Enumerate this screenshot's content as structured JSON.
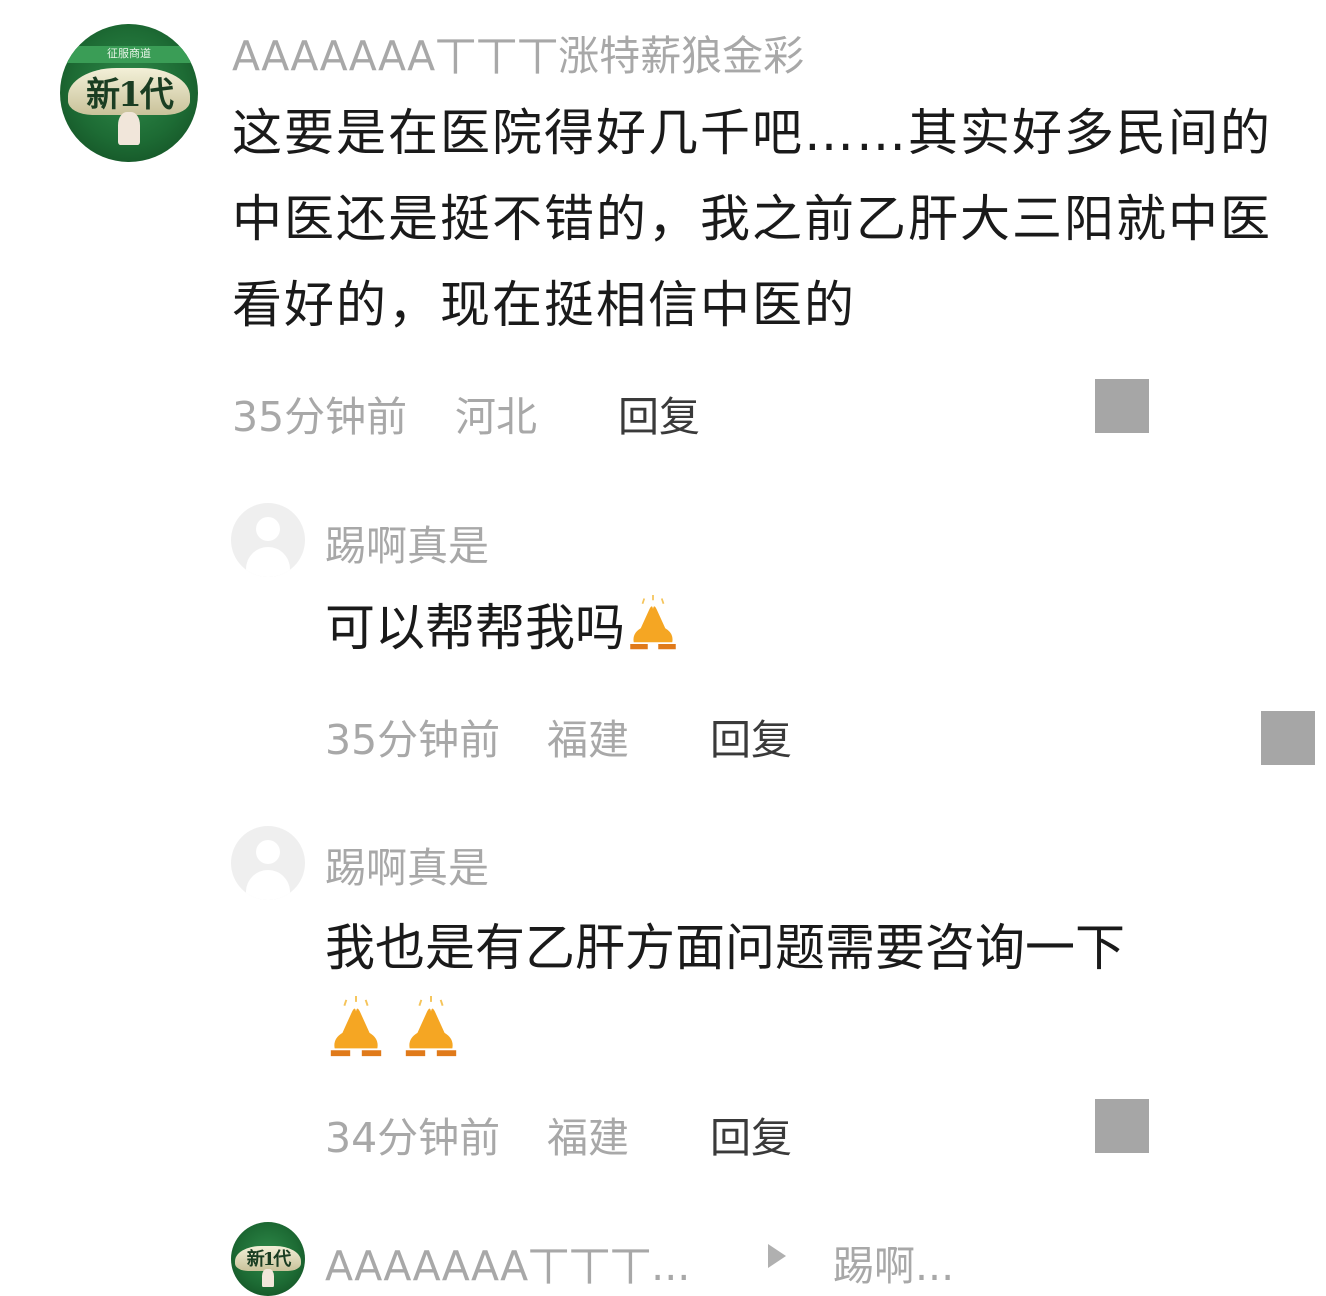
{
  "comments": [
    {
      "username": "AAAAAAA丅丅丅涨特薪狼金彩",
      "text": "这要是在医院得好几千吧……其实好多民间的中医还是挺不错的，我之前乙肝大三阳就中医看好的，现在挺相信中医的",
      "time": "35分钟前",
      "location": "河北",
      "reply_label": "回复",
      "avatar_banner": "征服商道",
      "avatar_logo": "新1代"
    }
  ],
  "replies": [
    {
      "username": "踢啊真是",
      "text": "可以帮帮我吗",
      "emoji_count": 1,
      "time": "35分钟前",
      "location": "福建",
      "reply_label": "回复"
    },
    {
      "username": "踢啊真是",
      "text": "我也是有乙肝方面问题需要咨询一下",
      "emoji_count": 2,
      "time": "34分钟前",
      "location": "福建",
      "reply_label": "回复"
    }
  ],
  "thread_footer": {
    "from_user": "AAAAAAA丅丅丅...",
    "to_user": "踢啊...",
    "avatar_logo": "新1代"
  },
  "icons": {
    "emoji": "folded-hands",
    "menu": "more-square",
    "arrow": "play-triangle"
  },
  "colors": {
    "username": "#a8a8a8",
    "text": "#1a1a1a",
    "meta": "#a8a8a8",
    "reply": "#3a3a3a",
    "menu_box": "#a6a6a6",
    "avatar_green": "#1d6b34"
  }
}
